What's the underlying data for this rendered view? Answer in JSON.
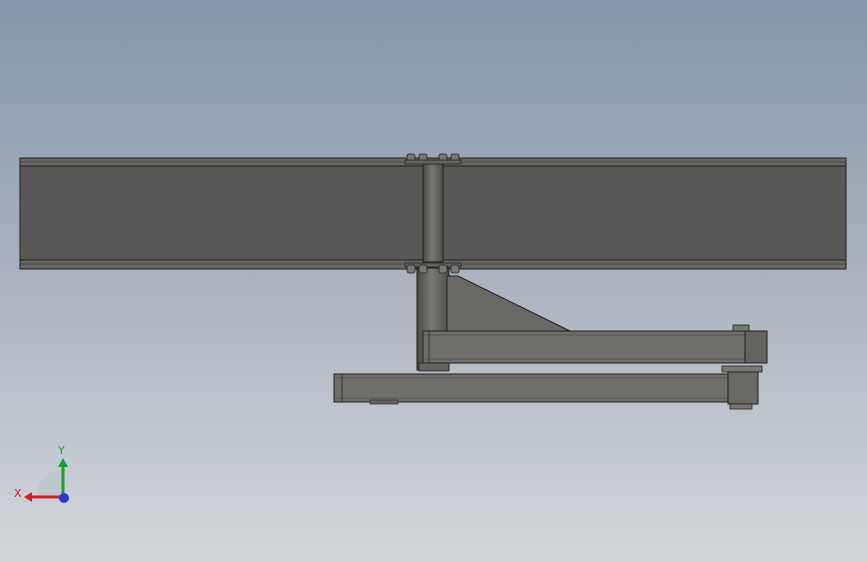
{
  "viewport": {
    "background_top": "#8796aa",
    "background_bottom": "#d3d7db"
  },
  "model": {
    "steel_dark": "#595856",
    "steel_mid": "#706e6a",
    "steel_light": "#8a8883",
    "edge": "#1e1e1e"
  },
  "triad": {
    "x_label": "X",
    "y_label": "Y",
    "x_color": "#c8202a",
    "y_color": "#1f9a35",
    "z_color": "#2c38c8"
  }
}
